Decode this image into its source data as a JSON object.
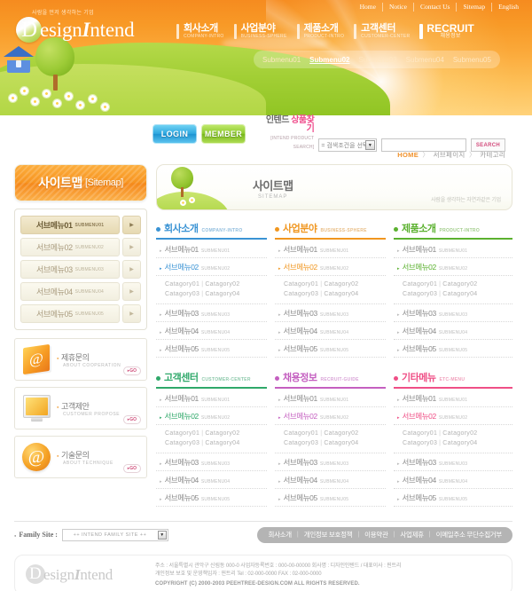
{
  "header": {
    "tagline": "사람을 먼저 생각하는 기업",
    "logo": {
      "d": "D",
      "rest_pre": "esign",
      "rest_i": "I",
      "rest_post": "ntend"
    },
    "topnav": [
      "Home",
      "Notice",
      "Contact Us",
      "Sitemap",
      "English"
    ],
    "mainnav": [
      {
        "ko": "회사소개",
        "en": "COMPANY-INTRO"
      },
      {
        "ko": "사업분야",
        "en": "BUSINESS-SPHERE"
      },
      {
        "ko": "제품소개",
        "en": "PRODUCT-INTRO"
      },
      {
        "ko": "고객센터",
        "en": "CUSTOMER-CENTER"
      },
      {
        "ko": "RECRUIT",
        "en": "채용정보"
      }
    ],
    "submenu": [
      "Submenu01",
      "Submenu02",
      "Submenu03",
      "Submenu04",
      "Submenu05"
    ],
    "submenu_active_index": 1
  },
  "util": {
    "login_label": "LOGIN",
    "member_label": "MEMBER",
    "search_title_ko_1": "인텐드 ",
    "search_title_ko_2": "상품찾기",
    "search_title_en": "[INTEND PRODUCT SEARCH]",
    "select_value": "= 검색조건을 선택 =",
    "select_arrow": "▼",
    "input_value": "",
    "input_placeholder": "",
    "search_button": "SEARCH"
  },
  "breadcrumb": {
    "home": "HOME",
    "sep": "〉",
    "level1": "서브페이지",
    "level2": "카테고리"
  },
  "sidebar": {
    "title_ko": "사이트맵",
    "title_en": "[Sitemap]",
    "menu": [
      {
        "ko": "서브메뉴01",
        "en": "SUBMENU01",
        "active": true
      },
      {
        "ko": "서브메뉴02",
        "en": "SUBMENU02",
        "active": false
      },
      {
        "ko": "서브메뉴03",
        "en": "SUBMENU03",
        "active": false
      },
      {
        "ko": "서브메뉴04",
        "en": "SUBMENU04",
        "active": false
      },
      {
        "ko": "서브메뉴05",
        "en": "SUBMENU05",
        "active": false
      }
    ],
    "arrow_glyph": "▶",
    "banners": [
      {
        "ko": "제휴문의",
        "en": "ABOUT  COOPERATION",
        "go": "GO",
        "icon": "book-icon",
        "glyph": "@"
      },
      {
        "ko": "고객제안",
        "en": "CUSTOMER  PROPOSE",
        "go": "GO",
        "icon": "monitor-icon",
        "glyph": ""
      },
      {
        "ko": "기술문의",
        "en": "ABOUT  TECHNIQUE",
        "go": "GO",
        "icon": "at-circle-icon",
        "glyph": "@"
      }
    ]
  },
  "page_banner": {
    "title_ko": "사이트맵",
    "title_en": "SITEMAP",
    "slogan": "사람을 생각하는 자연과같은 기업"
  },
  "sitemap": {
    "columns": [
      {
        "ko": "회사소개",
        "en": "COMPANY-INTRO",
        "color": "#3a93d4",
        "items": [
          {
            "ko": "서브메뉴01",
            "en": "SUBMENU01",
            "active": false
          },
          {
            "ko": "서브메뉴02",
            "en": "SUBMENU02",
            "active": true
          },
          {
            "ko": "서브메뉴03",
            "en": "SUBMENU03",
            "active": false
          },
          {
            "ko": "서브메뉴04",
            "en": "SUBMENU04",
            "active": false
          },
          {
            "ko": "서브메뉴05",
            "en": "SUBMENU05",
            "active": false
          }
        ],
        "categories": [
          "Catagory01",
          "Catagory02",
          "Catagory03",
          "Catagory04"
        ]
      },
      {
        "ko": "사업분야",
        "en": "BUSINESS-SPHERE",
        "color": "#f0961f",
        "items": [
          {
            "ko": "서브메뉴01",
            "en": "SUBMENU01",
            "active": false
          },
          {
            "ko": "서브메뉴02",
            "en": "SUBMENU02",
            "active": true
          },
          {
            "ko": "서브메뉴03",
            "en": "SUBMENU03",
            "active": false
          },
          {
            "ko": "서브메뉴04",
            "en": "SUBMENU04",
            "active": false
          },
          {
            "ko": "서브메뉴05",
            "en": "SUBMENU05",
            "active": false
          }
        ],
        "categories": [
          "Catagory01",
          "Catagory02",
          "Catagory03",
          "Catagory04"
        ]
      },
      {
        "ko": "제품소개",
        "en": "PRODUCT-INTRO",
        "color": "#5bb12f",
        "items": [
          {
            "ko": "서브메뉴01",
            "en": "SUBMENU01",
            "active": false
          },
          {
            "ko": "서브메뉴02",
            "en": "SUBMENU02",
            "active": true
          },
          {
            "ko": "서브메뉴03",
            "en": "SUBMENU03",
            "active": false
          },
          {
            "ko": "서브메뉴04",
            "en": "SUBMENU04",
            "active": false
          },
          {
            "ko": "서브메뉴05",
            "en": "SUBMENU05",
            "active": false
          }
        ],
        "categories": [
          "Catagory01",
          "Catagory02",
          "Catagory03",
          "Catagory04"
        ]
      },
      {
        "ko": "고객센터",
        "en": "CUSTOMER-CENTER",
        "color": "#2fa86a",
        "items": [
          {
            "ko": "서브메뉴01",
            "en": "SUBMENU01",
            "active": false
          },
          {
            "ko": "서브메뉴02",
            "en": "SUBMENU02",
            "active": true
          },
          {
            "ko": "서브메뉴03",
            "en": "SUBMENU03",
            "active": false
          },
          {
            "ko": "서브메뉴04",
            "en": "SUBMENU04",
            "active": false
          },
          {
            "ko": "서브메뉴05",
            "en": "SUBMENU05",
            "active": false
          }
        ],
        "categories": [
          "Catagory01",
          "Catagory02",
          "Catagory03",
          "Catagory04"
        ]
      },
      {
        "ko": "채용정보",
        "en": "RECRUIT-GUIDE",
        "color": "#c champion",
        "items": [
          {
            "ko": "서브메뉴01",
            "en": "SUBMENU01",
            "active": false
          },
          {
            "ko": "서브메뉴02",
            "en": "SUBMENU02",
            "active": true
          },
          {
            "ko": "서브메뉴03",
            "en": "SUBMENU03",
            "active": false
          },
          {
            "ko": "서브메뉴04",
            "en": "SUBMENU04",
            "active": false
          },
          {
            "ko": "서브메뉴05",
            "en": "SUBMENU05",
            "active": false
          }
        ],
        "categories": [
          "Catagory01",
          "Catagory02",
          "Catagory03",
          "Catagory04"
        ]
      },
      {
        "ko": "기타메뉴",
        "en": "ETC-MENU",
        "color": "#ef4f86",
        "items": [
          {
            "ko": "서브메뉴01",
            "en": "SUBMENU01",
            "active": false
          },
          {
            "ko": "서브메뉴02",
            "en": "SUBMENU02",
            "active": true
          },
          {
            "ko": "서브메뉴03",
            "en": "SUBMENU03",
            "active": false
          },
          {
            "ko": "서브메뉴04",
            "en": "SUBMENU04",
            "active": false
          },
          {
            "ko": "서브메뉴05",
            "en": "SUBMENU05",
            "active": false
          }
        ],
        "categories": [
          "Catagory01",
          "Catagory02",
          "Catagory03",
          "Catagory04"
        ]
      }
    ],
    "arrow_glyph": "▸",
    "cat_sep": "|"
  },
  "footer": {
    "family_label": "Family Site :",
    "family_value": "++ INTEND FAMILY SITE ++",
    "family_arrow": "▼",
    "links": [
      "회사소개",
      "개인정보 보호정책",
      "이용약관",
      "사업제휴",
      "이메일주소 무단수집거부"
    ],
    "link_sep": "|",
    "logo": {
      "d": "D",
      "rest_pre": "esign",
      "rest_i": "I",
      "rest_post": "ntend"
    },
    "address_line1": "주소 : 서울특별시 관악구 신림동 000-0  사업자등록번호 : 000-00-00000 회사명 : 디자인인텐드  / 대표이사 : 핀트리",
    "address_line2": "개인정보 보호 및 운영책임자 :  핀트리    Tel : 02-000-0000  FAX : 02-000-0000",
    "copyright": "COPYRIGHT (C) 2000-2003 PEEHTREE-DESIGN.COM  ALL RIGHTS RESERVED."
  },
  "colors": {
    "brand_orange": "#f68b1f",
    "accent_green": "#8cc92c",
    "accent_blue": "#2ea7e0",
    "accent_pink": "#ef4b8b"
  }
}
